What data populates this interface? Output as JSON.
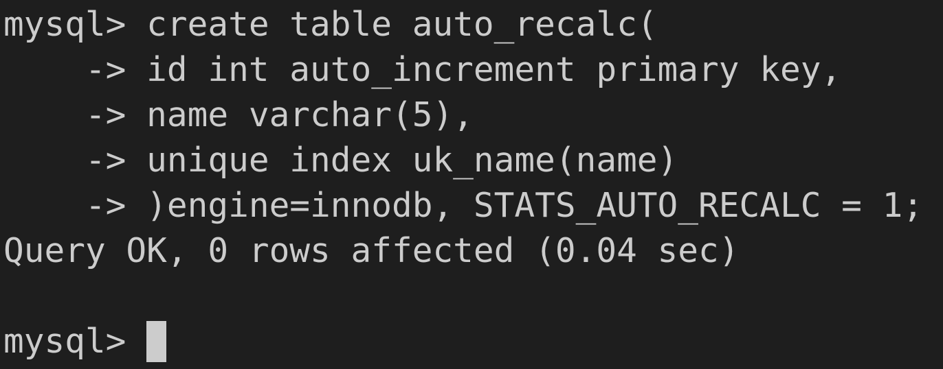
{
  "terminal": {
    "lines": [
      "mysql> create table auto_recalc(",
      "    -> id int auto_increment primary key,",
      "    -> name varchar(5),",
      "    -> unique index uk_name(name)",
      "    -> )engine=innodb, STATS_AUTO_RECALC = 1;",
      "Query OK, 0 rows affected (0.04 sec)",
      "",
      "mysql> "
    ]
  },
  "colors": {
    "background": "#1e1e1e",
    "foreground": "#cccccc",
    "cursor": "#cccccc"
  }
}
